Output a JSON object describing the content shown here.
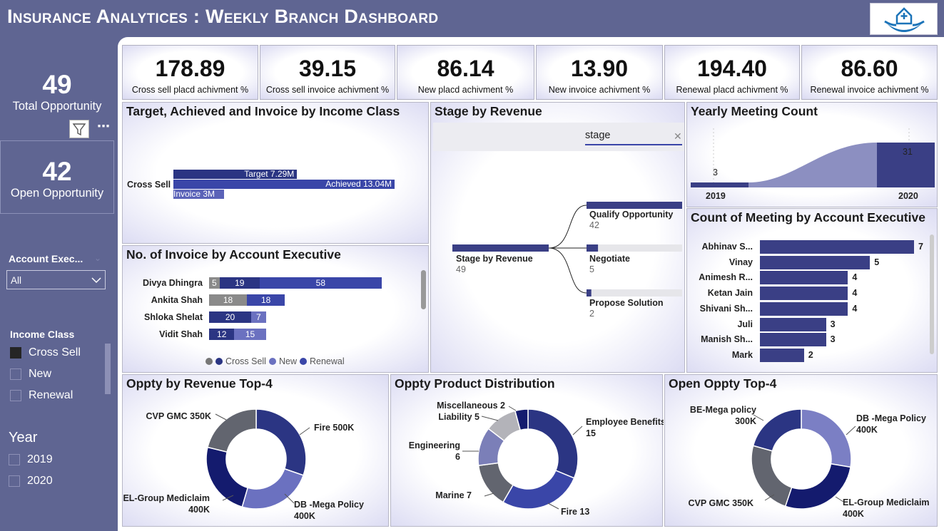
{
  "header": {
    "title": "Insurance Analytices : Weekly Branch Dashboard"
  },
  "logo": {
    "icon": "home-hands-logo-icon"
  },
  "sidebar": {
    "total": {
      "value": "49",
      "label": "Total Opportunity"
    },
    "open": {
      "value": "42",
      "label": "Open Opportunity"
    },
    "account_exec": {
      "label": "Account Exec...",
      "value": "All"
    },
    "income_class": {
      "label": "Income Class",
      "items": [
        {
          "label": "Cross Sell",
          "checked": true
        },
        {
          "label": "New",
          "checked": false
        },
        {
          "label": "Renewal",
          "checked": false
        }
      ]
    },
    "year": {
      "label": "Year",
      "items": [
        {
          "label": "2019"
        },
        {
          "label": "2020"
        }
      ]
    }
  },
  "kpis": [
    {
      "value": "178.89",
      "label": "Cross sell placd achivment %"
    },
    {
      "value": "39.15",
      "label": "Cross sell invoice achivment %"
    },
    {
      "value": "86.14",
      "label": "New placd achivment %"
    },
    {
      "value": "13.90",
      "label": "New invoice achivment %"
    },
    {
      "value": "194.40",
      "label": "Renewal placd achivment %"
    },
    {
      "value": "86.60",
      "label": "Renewal invoice achivment %"
    }
  ],
  "target_chart": {
    "title": "Target, Achieved and Invoice by Income Class",
    "category": "Cross Sell",
    "bars": [
      {
        "label": "Target 7.29M",
        "value": 7.29
      },
      {
        "label": "Achieved 13.04M",
        "value": 13.04
      },
      {
        "label": "Invoice 3M",
        "value": 3
      }
    ]
  },
  "invoice_chart": {
    "title": "No. of Invoice by Account Executive",
    "rows": [
      {
        "name": "Divya Dhingra",
        "segs": [
          5,
          19,
          58
        ]
      },
      {
        "name": "Ankita Shah",
        "segs": [
          18,
          18
        ]
      },
      {
        "name": "Shloka Shelat",
        "segs": [
          20,
          7
        ]
      },
      {
        "name": "Vidit Shah",
        "segs": [
          12,
          15
        ]
      }
    ],
    "legend": [
      "Cross Sell",
      "New",
      "Renewal"
    ]
  },
  "stage_chart": {
    "title": "Stage by Revenue",
    "search": "stage",
    "root": {
      "label": "Stage by Revenue",
      "value": "49"
    },
    "children": [
      {
        "label": "Qualify Opportunity",
        "value": "42",
        "frac": 1
      },
      {
        "label": "Negotiate",
        "value": "5",
        "frac": 0.12
      },
      {
        "label": "Propose Solution",
        "value": "2",
        "frac": 0.05
      }
    ]
  },
  "yearly_chart": {
    "title": "Yearly Meeting Count",
    "x": [
      "2019",
      "2020"
    ],
    "values": [
      3,
      31
    ]
  },
  "meeting_chart": {
    "title": "Count of Meeting by Account Executive",
    "rows": [
      {
        "name": "Abhinav S...",
        "value": 7
      },
      {
        "name": "Vinay",
        "value": 5
      },
      {
        "name": "Animesh R...",
        "value": 4
      },
      {
        "name": "Ketan Jain",
        "value": 4
      },
      {
        "name": "Shivani Sh...",
        "value": 4
      },
      {
        "name": "Juli",
        "value": 3
      },
      {
        "name": "Manish Sh...",
        "value": 3
      },
      {
        "name": "Mark",
        "value": 2
      }
    ]
  },
  "chart_data": [
    {
      "type": "pie",
      "title": "Oppty by Revenue Top-4",
      "labels": [
        "Fire 500K",
        "DB -Mega Policy 400K",
        "EL-Group Mediclaim 400K",
        "CVP GMC 350K"
      ],
      "values": [
        500,
        400,
        400,
        350
      ]
    },
    {
      "type": "pie",
      "title": "Oppty Product Distribution",
      "labels": [
        "Employee Benefits 15",
        "Fire 13",
        "Marine 7",
        "Engineering 6",
        "Liability 5",
        "Miscellaneous 2"
      ],
      "values": [
        15,
        13,
        7,
        6,
        5,
        2
      ]
    },
    {
      "type": "pie",
      "title": "Open Oppty Top-4",
      "labels": [
        "DB -Mega Policy 400K",
        "EL-Group Mediclaim 400K",
        "CVP GMC 350K",
        "BE-Mega policy 300K"
      ],
      "values": [
        400,
        400,
        350,
        300
      ]
    }
  ],
  "colors": {
    "cross": "#2b3583",
    "new": "#6b71c0",
    "renewal": "#3a46a8",
    "grey": "#8a8a8a"
  }
}
